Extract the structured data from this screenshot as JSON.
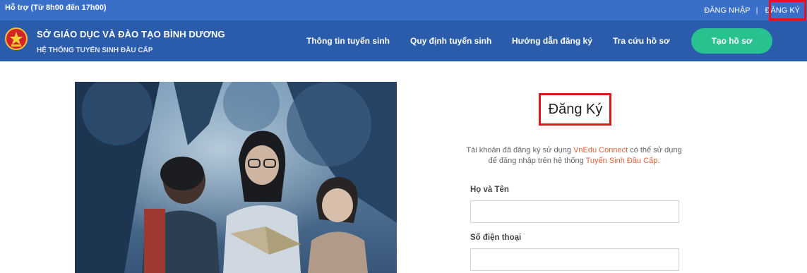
{
  "topbar": {
    "support_text": "Hỗ trợ (Từ 8h00 đến 17h00)",
    "login_label": "ĐĂNG NHẬP",
    "separator": "|",
    "register_label": "ĐĂNG KÝ"
  },
  "header": {
    "title": "SỞ GIÁO DỤC VÀ ĐÀO TẠO BÌNH DƯƠNG",
    "subtitle": "HỆ THỐNG TUYỂN SINH ĐẦU CẤP",
    "logo_icon": "national-emblem-icon",
    "nav": [
      {
        "label": "Thông tin tuyển sinh"
      },
      {
        "label": "Quy định tuyển sinh"
      },
      {
        "label": "Hướng dẫn đăng ký"
      },
      {
        "label": "Tra cứu hồ sơ"
      }
    ],
    "cta_label": "Tạo hồ sơ"
  },
  "form": {
    "title": "Đăng Ký",
    "desc_part1": "Tài khoản đã đăng ký sử dụng ",
    "desc_link1": "VnEdu Connect",
    "desc_part2": " có thể sử dụng để đăng nhập trên hệ thống ",
    "desc_link2": "Tuyển Sinh Đầu Cấp",
    "desc_part3": ".",
    "fields": [
      {
        "label": "Họ và Tên",
        "value": "",
        "placeholder": ""
      },
      {
        "label": "Số điện thoại",
        "value": "",
        "placeholder": ""
      }
    ]
  },
  "colors": {
    "topbar_bg": "#3a6fc9",
    "navbar_bg": "#2a5cab",
    "cta_bg": "#27c28f",
    "link": "#e2603a",
    "highlight": "#e0141c"
  }
}
